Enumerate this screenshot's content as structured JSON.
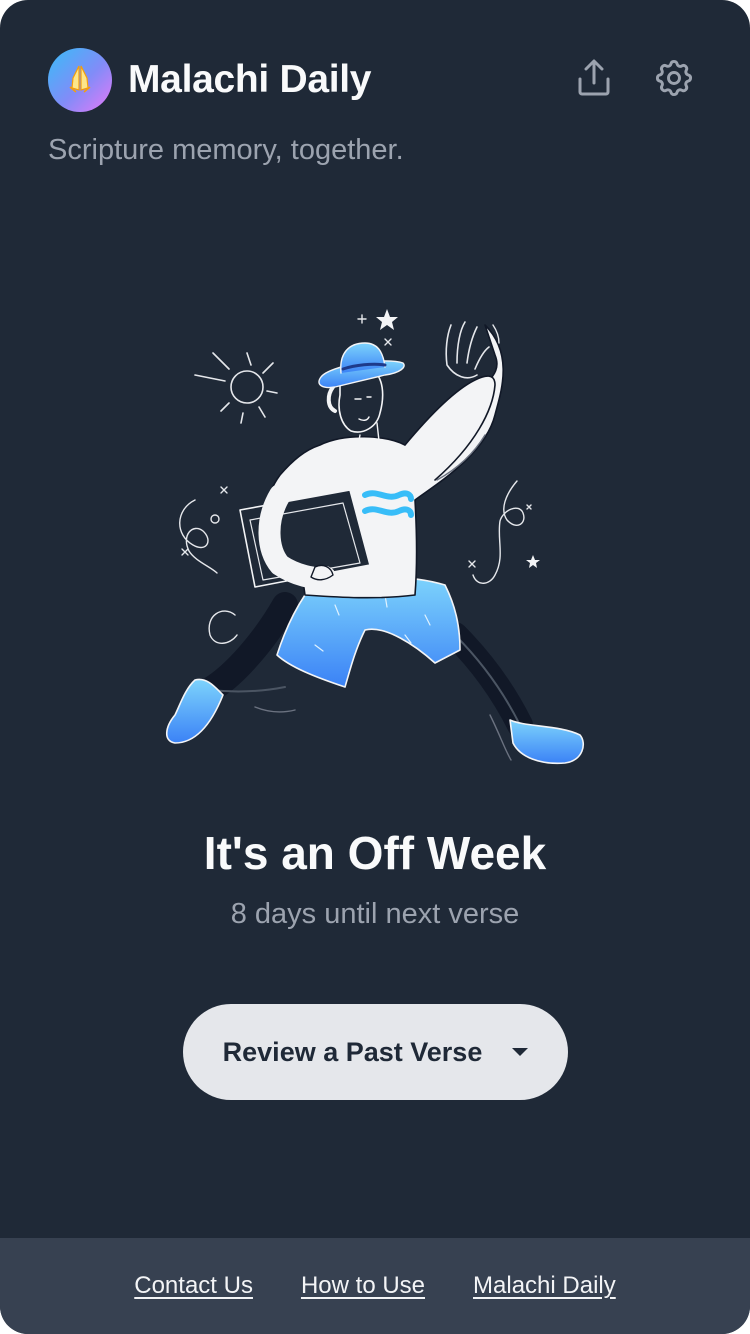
{
  "app": {
    "title": "Malachi Daily",
    "tagline": "Scripture memory, together.",
    "logo_icon": "praying-hands-icon"
  },
  "header": {
    "share_icon": "share-icon",
    "settings_icon": "gear-icon"
  },
  "status": {
    "headline": "It's an Off Week",
    "subline": "8 days until next verse"
  },
  "actions": {
    "review_label": "Review a Past Verse",
    "review_icon": "caret-down-icon"
  },
  "footer": {
    "links": [
      {
        "label": "Contact Us"
      },
      {
        "label": "How to Use"
      },
      {
        "label": "Malachi Daily"
      }
    ]
  },
  "colors": {
    "background": "#1f2937",
    "footer_bg": "#374151",
    "button_bg": "#e5e7eb",
    "accent": "#38bdf8"
  }
}
